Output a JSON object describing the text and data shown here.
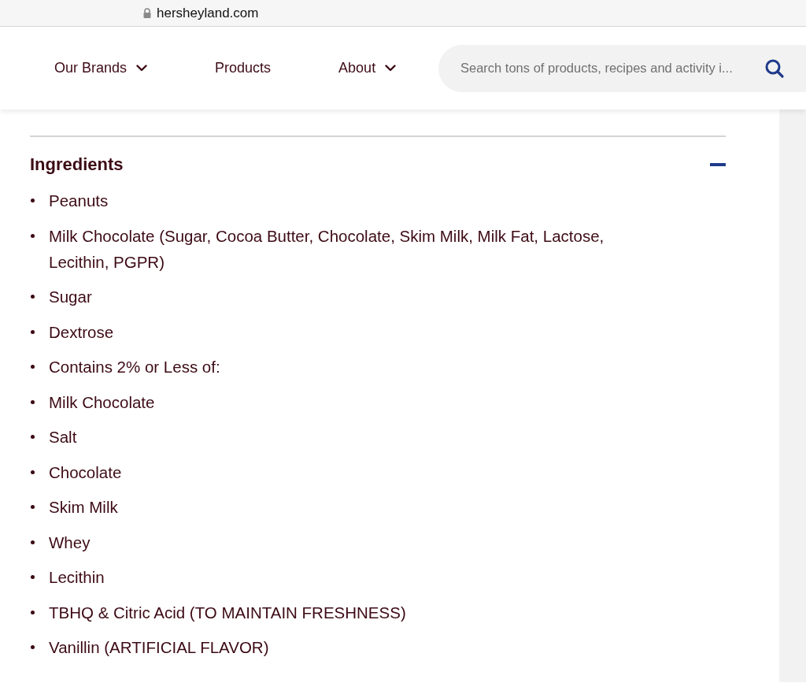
{
  "address_bar": {
    "url": "hersheyland.com"
  },
  "nav": {
    "items": [
      {
        "label": "Our Brands",
        "dropdown": true
      },
      {
        "label": "Products",
        "dropdown": false
      },
      {
        "label": "About",
        "dropdown": true
      }
    ],
    "search": {
      "placeholder": "Search tons of products, recipes and activity i..."
    }
  },
  "section": {
    "title": "Ingredients",
    "expanded": true,
    "items": [
      "Peanuts",
      "Milk Chocolate (Sugar, Cocoa Butter, Chocolate, Skim Milk, Milk Fat, Lactose, Lecithin, PGPR)",
      "Sugar",
      "Dextrose",
      "Contains 2% or Less of:",
      "Milk Chocolate",
      "Salt",
      "Chocolate",
      "Skim Milk",
      "Whey",
      "Lecithin",
      "TBHQ & Citric Acid (TO MAINTAIN FRESHNESS)",
      "Vanillin (ARTIFICIAL FLAVOR)"
    ]
  }
}
